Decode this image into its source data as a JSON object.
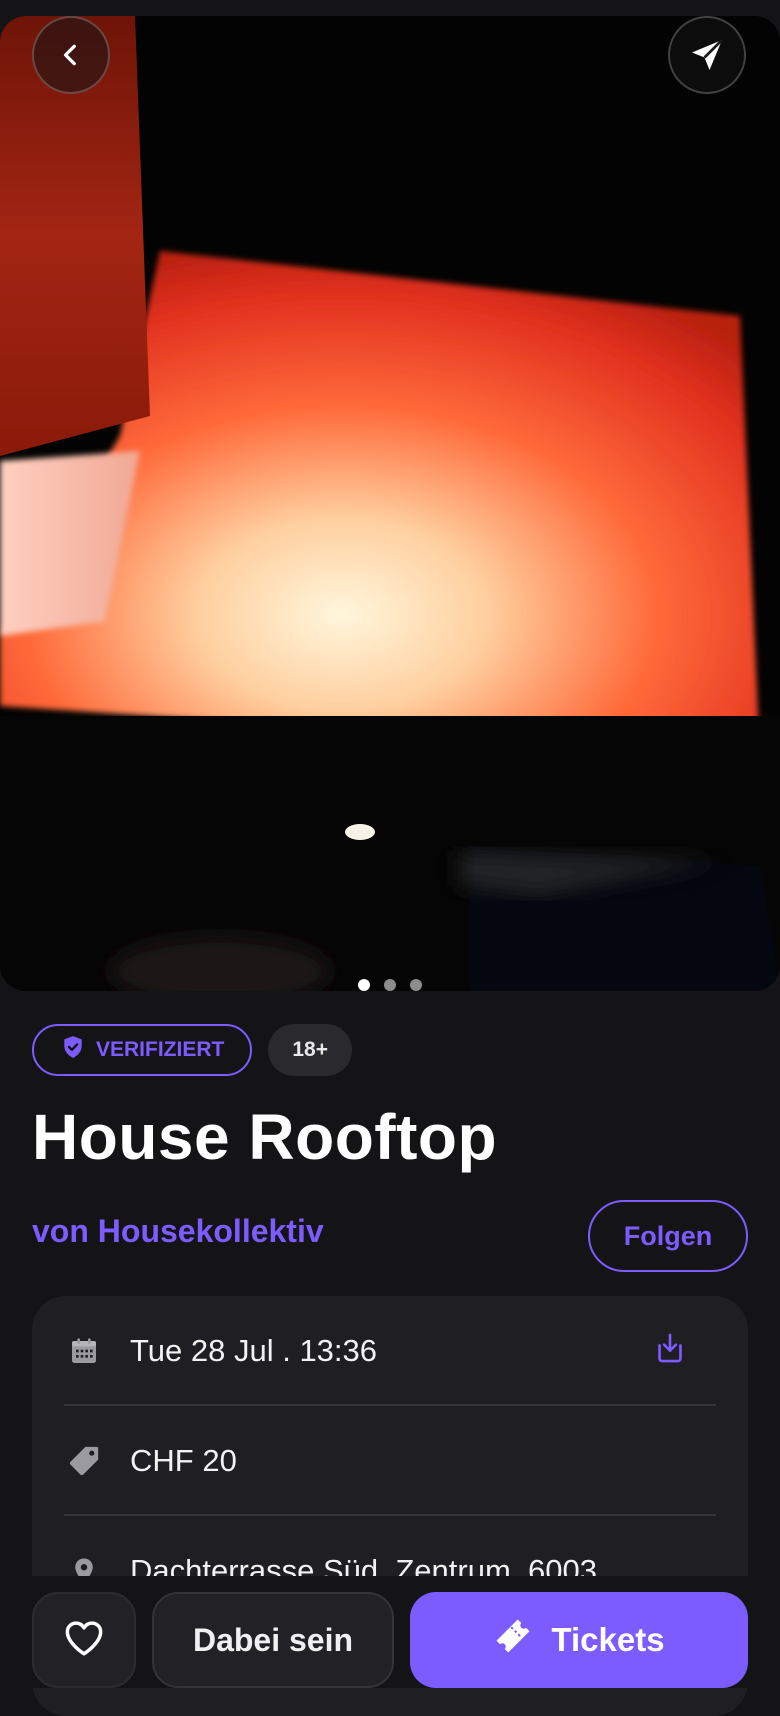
{
  "hero": {
    "image_description": "",
    "carousel": {
      "total": 3,
      "active": 1
    }
  },
  "top_bar": {
    "back_icon": "chevron-left-icon",
    "share_icon": "send-icon"
  },
  "badges": {
    "verified_label": "VERIFIZIERT",
    "age_label": "18+"
  },
  "event": {
    "title": "House Rooftop",
    "organizer": "von Housekollektiv",
    "follow_label": "Folgen"
  },
  "details": {
    "date": "Tue 28 Jul . 13:36",
    "price": "CHF 20",
    "location": "Dachterrasse Süd, Zentrum, 6003"
  },
  "actions": {
    "join_label": "Dabei sein",
    "tickets_label": "Tickets"
  },
  "colors": {
    "accent": "#7d5cff",
    "background": "#141417",
    "card": "#1f1f23"
  }
}
